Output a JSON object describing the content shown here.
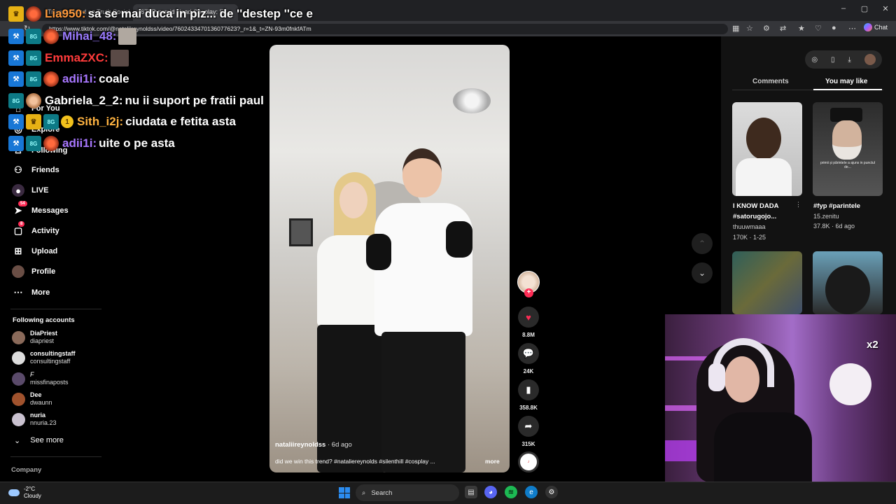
{
  "browser": {
    "tabs": [
      "Trump posted on Truth Social",
      "(67) Pyramid Head Cosplay: E..."
    ],
    "url": "https://www.tiktok.com/@nataliireynoldss/video/7602433470136077623?_r=1&_t=ZN-93m0fnkfATm",
    "chat_label": "Chat"
  },
  "sidebar": {
    "items": [
      {
        "label": "For You",
        "icon": "home-icon"
      },
      {
        "label": "Explore",
        "icon": "compass-icon"
      },
      {
        "label": "Following",
        "icon": "following-icon"
      },
      {
        "label": "Friends",
        "icon": "friends-icon"
      },
      {
        "label": "LIVE",
        "icon": "live-icon"
      },
      {
        "label": "Messages",
        "icon": "messages-icon",
        "badge": "54"
      },
      {
        "label": "Activity",
        "icon": "activity-icon",
        "badge": "8"
      },
      {
        "label": "Upload",
        "icon": "upload-icon"
      },
      {
        "label": "Profile",
        "icon": "profile-icon"
      },
      {
        "label": "More",
        "icon": "more-icon"
      }
    ],
    "following_title": "Following accounts",
    "accounts": [
      {
        "name": "DiaPriest",
        "handle": "diapriest"
      },
      {
        "name": "consultingstaff",
        "handle": "consultingstaff"
      },
      {
        "name": "F",
        "handle": "missfinaposts"
      },
      {
        "name": "Dee",
        "handle": "dwaunn"
      },
      {
        "name": "nuria",
        "handle": "nnuria.23"
      }
    ],
    "see_more": "See more",
    "company": "Company"
  },
  "video": {
    "username": "nataliireynoldss",
    "age": " · 6d ago",
    "caption": "did we win this trend? #nataliereynolds #silenthill #cosplay ...",
    "more": "more",
    "likes": "8.8M",
    "comments": "24K",
    "saves": "358.8K",
    "shares": "315K"
  },
  "right_panel": {
    "tabs": [
      "Comments",
      "You may like"
    ],
    "active_tab": "You may like",
    "thumbs": [
      {
        "title": "I KNOW DADA #satorugojo...",
        "author": "thuuwmaaa",
        "meta": "170K · 1-25"
      },
      {
        "title": "#fyp #parintele",
        "author": "15.zenitu",
        "meta": "37.8K · 6d ago",
        "overlay": "primii și părinteIe a ajuns in punctul de..."
      }
    ]
  },
  "chat": [
    {
      "user": "Lia950:",
      "color": "#ff9a3d",
      "msg": "sa se mai duca in piz... de ''destep ''ce e",
      "badges": [
        "crown"
      ]
    },
    {
      "user": "Mihai_48:",
      "color": "#9b7bff",
      "msg": "",
      "badges": [
        "prime",
        "7tv"
      ],
      "image": true
    },
    {
      "user": "EmmaZXC:",
      "color": "#ff3b3b",
      "msg": "",
      "badges": [
        "prime",
        "7tv"
      ],
      "image": true
    },
    {
      "user": "adii1i:",
      "color": "#a877ff",
      "msg": "coale",
      "badges": [
        "prime",
        "7tv"
      ]
    },
    {
      "user": "Gabriela_2_2:",
      "color": "#ffffff",
      "msg": "nu ii suport pe fratii paul",
      "badges": [
        "7tv"
      ]
    },
    {
      "user": "Sith_i2j:",
      "color": "#ffb341",
      "msg": "ciudata e fetita asta",
      "badges": [
        "prime",
        "crown",
        "7tv",
        "gold"
      ]
    },
    {
      "user": "adii1i:",
      "color": "#a877ff",
      "msg": "uite o pe asta",
      "badges": [
        "prime",
        "7tv"
      ]
    }
  ],
  "chat_gold_badge": "1",
  "webcam": {
    "multiplier": "x2"
  },
  "taskbar": {
    "temperature": "-2°C",
    "condition": "Cloudy",
    "search": "Search"
  },
  "colors": {
    "accent": "#fe2c55",
    "background": "#000000"
  }
}
